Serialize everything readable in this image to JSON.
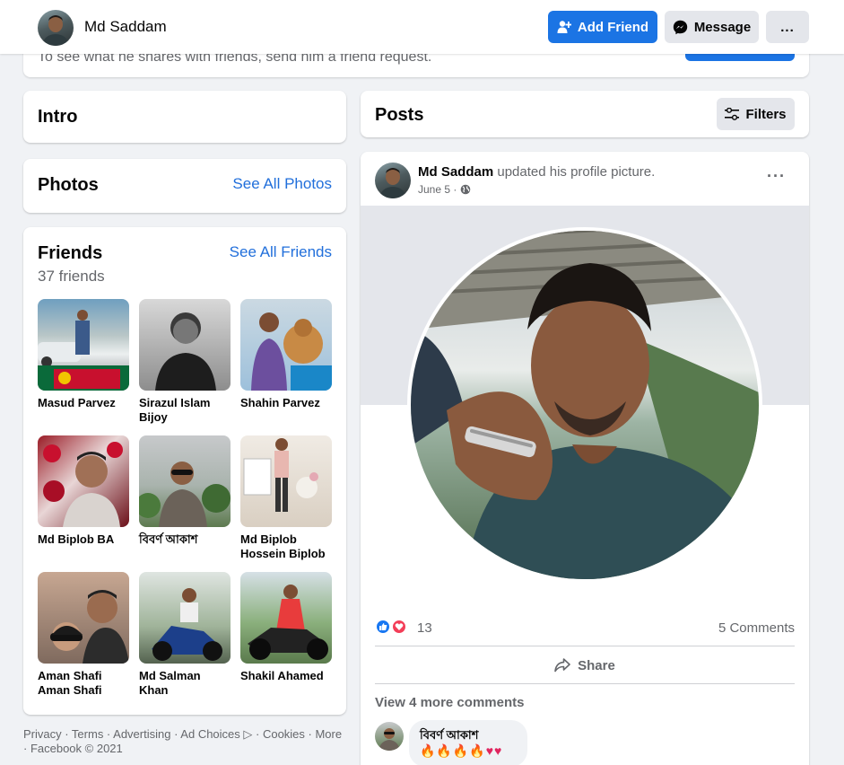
{
  "profile": {
    "name": "Md Saddam"
  },
  "actions": {
    "add_friend": "Add Friend",
    "message": "Message",
    "more": "..."
  },
  "strip_text": "To see what he shares with friends, send him a friend request.",
  "intro": {
    "title": "Intro"
  },
  "photos": {
    "title": "Photos",
    "see_all": "See All Photos"
  },
  "friends": {
    "title": "Friends",
    "count_text": "37 friends",
    "see_all": "See All Friends",
    "list": [
      {
        "name": "Masud Parvez"
      },
      {
        "name": "Sirazul Islam Bijoy"
      },
      {
        "name": "Shahin Parvez"
      },
      {
        "name": "Md Biplob BA"
      },
      {
        "name": "বিবর্ণ আকাশ"
      },
      {
        "name": "Md Biplob Hossein Biplob"
      },
      {
        "name": "Aman Shafi Aman Shafi"
      },
      {
        "name": "Md Salman Khan"
      },
      {
        "name": "Shakil Ahamed"
      }
    ]
  },
  "footer": {
    "text": "Privacy · Terms · Advertising · Ad Choices ▷ · Cookies · More · Facebook © 2021"
  },
  "posts": {
    "title": "Posts",
    "filters": "Filters"
  },
  "post": {
    "author": "Md Saddam",
    "action": "updated his profile picture.",
    "date": "June 5 ·",
    "reaction_count": "13",
    "comments_count": "5 Comments",
    "share": "Share",
    "view_more": "View 4 more comments",
    "comment": {
      "author": "বিবর্ণ আকাশ",
      "text": "🔥🔥🔥🔥♥♥"
    }
  },
  "colors": {
    "accent": "#1b74e4",
    "link": "#216fdb",
    "background": "#f0f2f5"
  }
}
